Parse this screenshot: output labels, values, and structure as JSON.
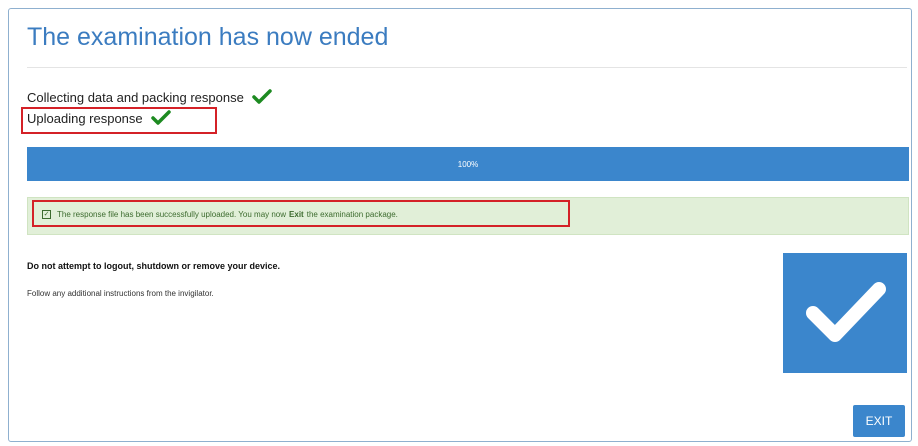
{
  "header": {
    "title": "The examination has now ended"
  },
  "steps": [
    {
      "label": "Collecting data and packing response",
      "status_icon": "check-icon"
    },
    {
      "label": "Uploading response",
      "status_icon": "check-icon"
    }
  ],
  "progress": {
    "value_percent": 100,
    "label": "100%"
  },
  "alert": {
    "text_before": "The response file has been successfully uploaded. You may now",
    "emphasis": "Exit",
    "text_after": "the examination package."
  },
  "instructions": {
    "warning": "Do not attempt to logout, shutdown or remove your device.",
    "info": "Follow any additional instructions from the invigilator."
  },
  "exit_button": {
    "label": "EXIT"
  },
  "colors": {
    "accent": "#3b86cc",
    "title": "#3b7cc0",
    "success_bg": "#e1efd8",
    "success_text": "#3c6b2e",
    "check_green": "#1d8a21",
    "highlight_red": "#d42127"
  }
}
